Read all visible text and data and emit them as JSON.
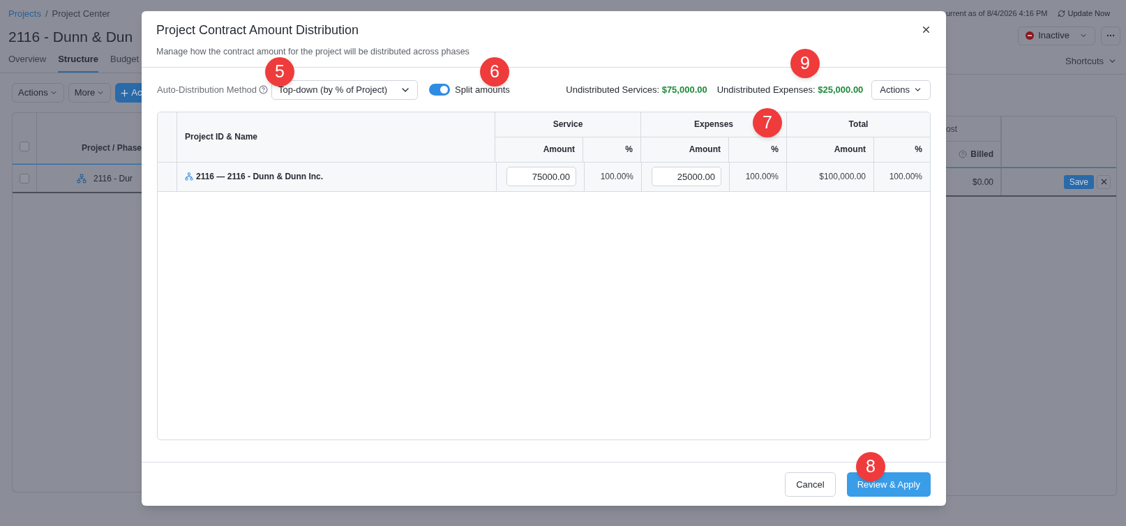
{
  "page": {
    "breadcrumb": {
      "parent": "Projects",
      "separator": "/",
      "current": "Project Center"
    },
    "title": "2116 - Dunn & Dun",
    "tabs": [
      {
        "label": "Overview",
        "selected": false
      },
      {
        "label": "Structure",
        "selected": true
      },
      {
        "label": "Budget",
        "selected": false
      }
    ],
    "toolbar": [
      {
        "label": "Actions",
        "kind": "menu"
      },
      {
        "label": "More",
        "kind": "menu"
      },
      {
        "label": "Ac",
        "kind": "add"
      }
    ],
    "table": {
      "header_checked": false,
      "column_header": "Project / Phase",
      "row": {
        "checked": false,
        "name": "2116 - Dur"
      }
    },
    "status_note": "urrent as of 8/4/2026 4:16 PM",
    "update_button": "Update Now",
    "status_select": "Inactive",
    "shortcuts": "Shortcuts",
    "right_table": {
      "group_header": "ost",
      "column_header": "Billed",
      "value": "$0.00",
      "save_button": "Save"
    }
  },
  "modal": {
    "title": "Project Contract Amount Distribution",
    "subtitle": "Manage how the contract amount for the project will be distributed across phases",
    "method_label": "Auto-Distribution Method",
    "method_value": "Top-down (by % of Project)",
    "split": {
      "label": "Split amounts",
      "on": true
    },
    "undistributed": [
      {
        "label": "Undistributed Services:",
        "amount": "$75,000.00"
      },
      {
        "label": "Undistributed Expenses:",
        "amount": "$25,000.00"
      }
    ],
    "actions_button": "Actions",
    "table": {
      "name_header": "Project ID & Name",
      "groups": [
        {
          "label": "Service",
          "columns": [
            "Amount",
            "%"
          ]
        },
        {
          "label": "Expenses",
          "columns": [
            "Amount",
            "%"
          ]
        },
        {
          "label": "Total",
          "columns": [
            "Amount",
            "%"
          ]
        }
      ],
      "rows": [
        {
          "name": "2116 — 2116 - Dunn & Dunn Inc.",
          "cells": [
            {
              "kind": "input",
              "value": "75000.00"
            },
            {
              "kind": "text",
              "value": "100.00%"
            },
            {
              "kind": "input",
              "value": "25000.00"
            },
            {
              "kind": "text",
              "value": "100.00%"
            },
            {
              "kind": "text",
              "value": "$100,000.00"
            },
            {
              "kind": "text",
              "value": "100.00%"
            }
          ]
        }
      ]
    },
    "buttons": [
      {
        "label": "Cancel",
        "kind": "secondary"
      },
      {
        "label": "Review & Apply",
        "kind": "primary"
      }
    ]
  },
  "callouts": [
    {
      "label": "5"
    },
    {
      "label": "6"
    },
    {
      "label": "9"
    },
    {
      "label": "7"
    },
    {
      "label": "8"
    }
  ]
}
